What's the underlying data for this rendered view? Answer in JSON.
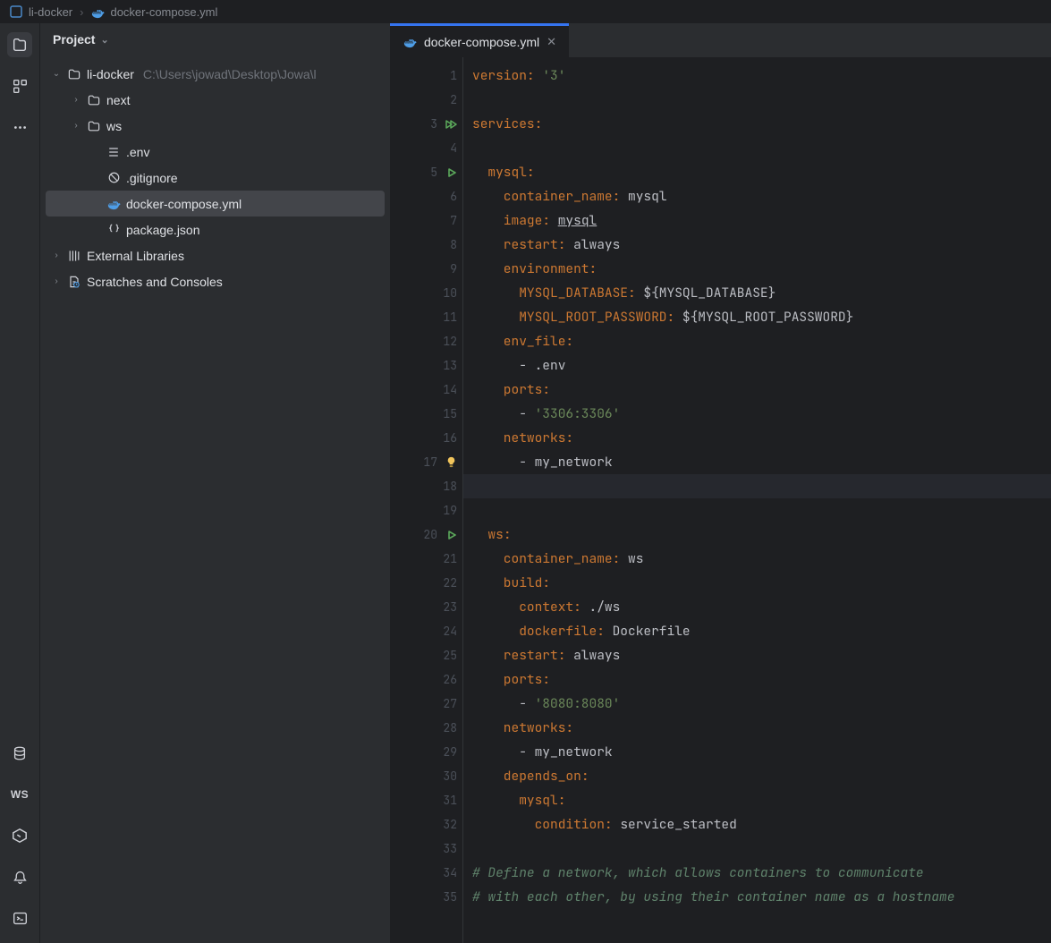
{
  "breadcrumb": {
    "project": "li-docker",
    "file": "docker-compose.yml"
  },
  "project_panel": {
    "title": "Project",
    "tree": [
      {
        "id": "root",
        "level": 0,
        "chev": "down",
        "icon": "folder",
        "label": "li-docker",
        "path": "C:\\Users\\jowad\\Desktop\\Jowa\\l"
      },
      {
        "id": "next",
        "level": 1,
        "chev": "right",
        "icon": "folder",
        "label": "next"
      },
      {
        "id": "ws",
        "level": 1,
        "chev": "right",
        "icon": "folder",
        "label": "ws"
      },
      {
        "id": "env",
        "level": 2,
        "chev": "",
        "icon": "env",
        "label": ".env"
      },
      {
        "id": "gitignore",
        "level": 2,
        "chev": "",
        "icon": "ignore",
        "label": ".gitignore"
      },
      {
        "id": "compose",
        "level": 2,
        "chev": "",
        "icon": "docker",
        "label": "docker-compose.yml",
        "selected": true
      },
      {
        "id": "pkg",
        "level": 2,
        "chev": "",
        "icon": "json",
        "label": "package.json"
      },
      {
        "id": "extlib",
        "level": 0,
        "chev": "right",
        "icon": "lib",
        "label": "External Libraries"
      },
      {
        "id": "scratch",
        "level": 0,
        "chev": "right",
        "icon": "scratch",
        "label": "Scratches and Consoles"
      }
    ]
  },
  "tab": {
    "label": "docker-compose.yml"
  },
  "code": {
    "line_numbers": [
      1,
      2,
      3,
      4,
      5,
      6,
      7,
      8,
      9,
      10,
      11,
      12,
      13,
      14,
      15,
      16,
      17,
      18,
      19,
      20,
      21,
      22,
      23,
      24,
      25,
      26,
      27,
      28,
      29,
      30,
      31,
      32,
      33,
      34,
      35
    ],
    "gutter_icons": {
      "3": "run2",
      "5": "run",
      "17": "bulb",
      "20": "run"
    },
    "current_line": 18,
    "lines": [
      [
        {
          "t": "version",
          "c": "k-key"
        },
        {
          "t": ": ",
          "c": "k-colon"
        },
        {
          "t": "'3'",
          "c": "k-str"
        }
      ],
      [],
      [
        {
          "t": "services",
          "c": "k-key"
        },
        {
          "t": ":",
          "c": "k-colon"
        }
      ],
      [],
      [
        {
          "t": "  mysql",
          "c": "k-key"
        },
        {
          "t": ":",
          "c": "k-colon"
        }
      ],
      [
        {
          "t": "    container_name",
          "c": "k-key"
        },
        {
          "t": ": ",
          "c": "k-colon"
        },
        {
          "t": "mysql",
          "c": "k-val"
        }
      ],
      [
        {
          "t": "    image",
          "c": "k-key"
        },
        {
          "t": ": ",
          "c": "k-colon"
        },
        {
          "t": "mysql",
          "c": "k-link"
        }
      ],
      [
        {
          "t": "    restart",
          "c": "k-key"
        },
        {
          "t": ": ",
          "c": "k-colon"
        },
        {
          "t": "always",
          "c": "k-val"
        }
      ],
      [
        {
          "t": "    environment",
          "c": "k-key"
        },
        {
          "t": ":",
          "c": "k-colon"
        }
      ],
      [
        {
          "t": "      MYSQL_DATABASE",
          "c": "k-key"
        },
        {
          "t": ": ",
          "c": "k-colon"
        },
        {
          "t": "${MYSQL_DATABASE}",
          "c": "k-var"
        }
      ],
      [
        {
          "t": "      MYSQL_ROOT_PASSWORD",
          "c": "k-key"
        },
        {
          "t": ": ",
          "c": "k-colon"
        },
        {
          "t": "${MYSQL_ROOT_PASSWORD}",
          "c": "k-var"
        }
      ],
      [
        {
          "t": "    env_file",
          "c": "k-key"
        },
        {
          "t": ":",
          "c": "k-colon"
        }
      ],
      [
        {
          "t": "      - ",
          "c": "k-val"
        },
        {
          "t": ".env",
          "c": "k-val"
        }
      ],
      [
        {
          "t": "    ports",
          "c": "k-key"
        },
        {
          "t": ":",
          "c": "k-colon"
        }
      ],
      [
        {
          "t": "      - ",
          "c": "k-val"
        },
        {
          "t": "'3306:3306'",
          "c": "k-str"
        }
      ],
      [
        {
          "t": "    networks",
          "c": "k-key"
        },
        {
          "t": ":",
          "c": "k-colon"
        }
      ],
      [
        {
          "t": "      - ",
          "c": "k-val"
        },
        {
          "t": "my_network",
          "c": "k-val"
        }
      ],
      [],
      [],
      [
        {
          "t": "  ws",
          "c": "k-key"
        },
        {
          "t": ":",
          "c": "k-colon"
        }
      ],
      [
        {
          "t": "    container_name",
          "c": "k-key"
        },
        {
          "t": ": ",
          "c": "k-colon"
        },
        {
          "t": "ws",
          "c": "k-val"
        }
      ],
      [
        {
          "t": "    build",
          "c": "k-key"
        },
        {
          "t": ":",
          "c": "k-colon"
        }
      ],
      [
        {
          "t": "      context",
          "c": "k-key"
        },
        {
          "t": ": ",
          "c": "k-colon"
        },
        {
          "t": "./ws",
          "c": "k-val"
        }
      ],
      [
        {
          "t": "      dockerfile",
          "c": "k-key"
        },
        {
          "t": ": ",
          "c": "k-colon"
        },
        {
          "t": "Dockerfile",
          "c": "k-val"
        }
      ],
      [
        {
          "t": "    restart",
          "c": "k-key"
        },
        {
          "t": ": ",
          "c": "k-colon"
        },
        {
          "t": "always",
          "c": "k-val"
        }
      ],
      [
        {
          "t": "    ports",
          "c": "k-key"
        },
        {
          "t": ":",
          "c": "k-colon"
        }
      ],
      [
        {
          "t": "      - ",
          "c": "k-val"
        },
        {
          "t": "'8080:8080'",
          "c": "k-str"
        }
      ],
      [
        {
          "t": "    networks",
          "c": "k-key"
        },
        {
          "t": ":",
          "c": "k-colon"
        }
      ],
      [
        {
          "t": "      - ",
          "c": "k-val"
        },
        {
          "t": "my_network",
          "c": "k-val"
        }
      ],
      [
        {
          "t": "    depends_on",
          "c": "k-key"
        },
        {
          "t": ":",
          "c": "k-colon"
        }
      ],
      [
        {
          "t": "      mysql",
          "c": "k-key"
        },
        {
          "t": ":",
          "c": "k-colon"
        }
      ],
      [
        {
          "t": "        condition",
          "c": "k-key"
        },
        {
          "t": ": ",
          "c": "k-colon"
        },
        {
          "t": "service_started",
          "c": "k-val"
        }
      ],
      [],
      [
        {
          "t": "# Define a network, which allows containers to communicate",
          "c": "k-cmt"
        }
      ],
      [
        {
          "t": "# with each other, by using their container name as a hostname",
          "c": "k-cmt"
        }
      ]
    ]
  }
}
